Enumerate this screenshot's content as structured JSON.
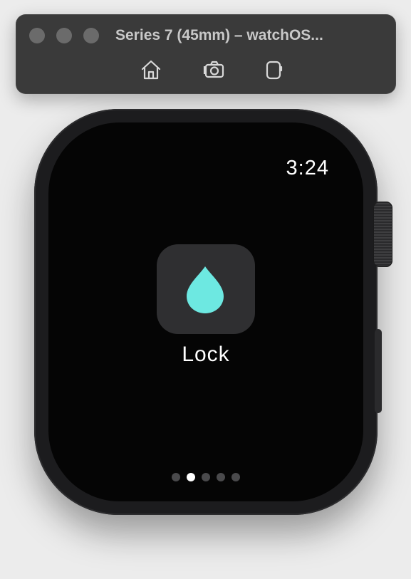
{
  "window": {
    "title": "Series 7 (45mm) – watchOS...",
    "toolbar": [
      {
        "name": "home-icon"
      },
      {
        "name": "screenshot-icon"
      },
      {
        "name": "rotate-device-icon"
      }
    ]
  },
  "watch": {
    "time": "3:24",
    "app": {
      "label": "Lock",
      "icon": "water-drop-icon",
      "icon_color": "#6de8e1"
    },
    "page_indicator": {
      "count": 5,
      "active_index": 1
    }
  },
  "colors": {
    "screen_background": "#050505",
    "icon_tile": "#2f2f31",
    "accent": "#6de8e1"
  }
}
